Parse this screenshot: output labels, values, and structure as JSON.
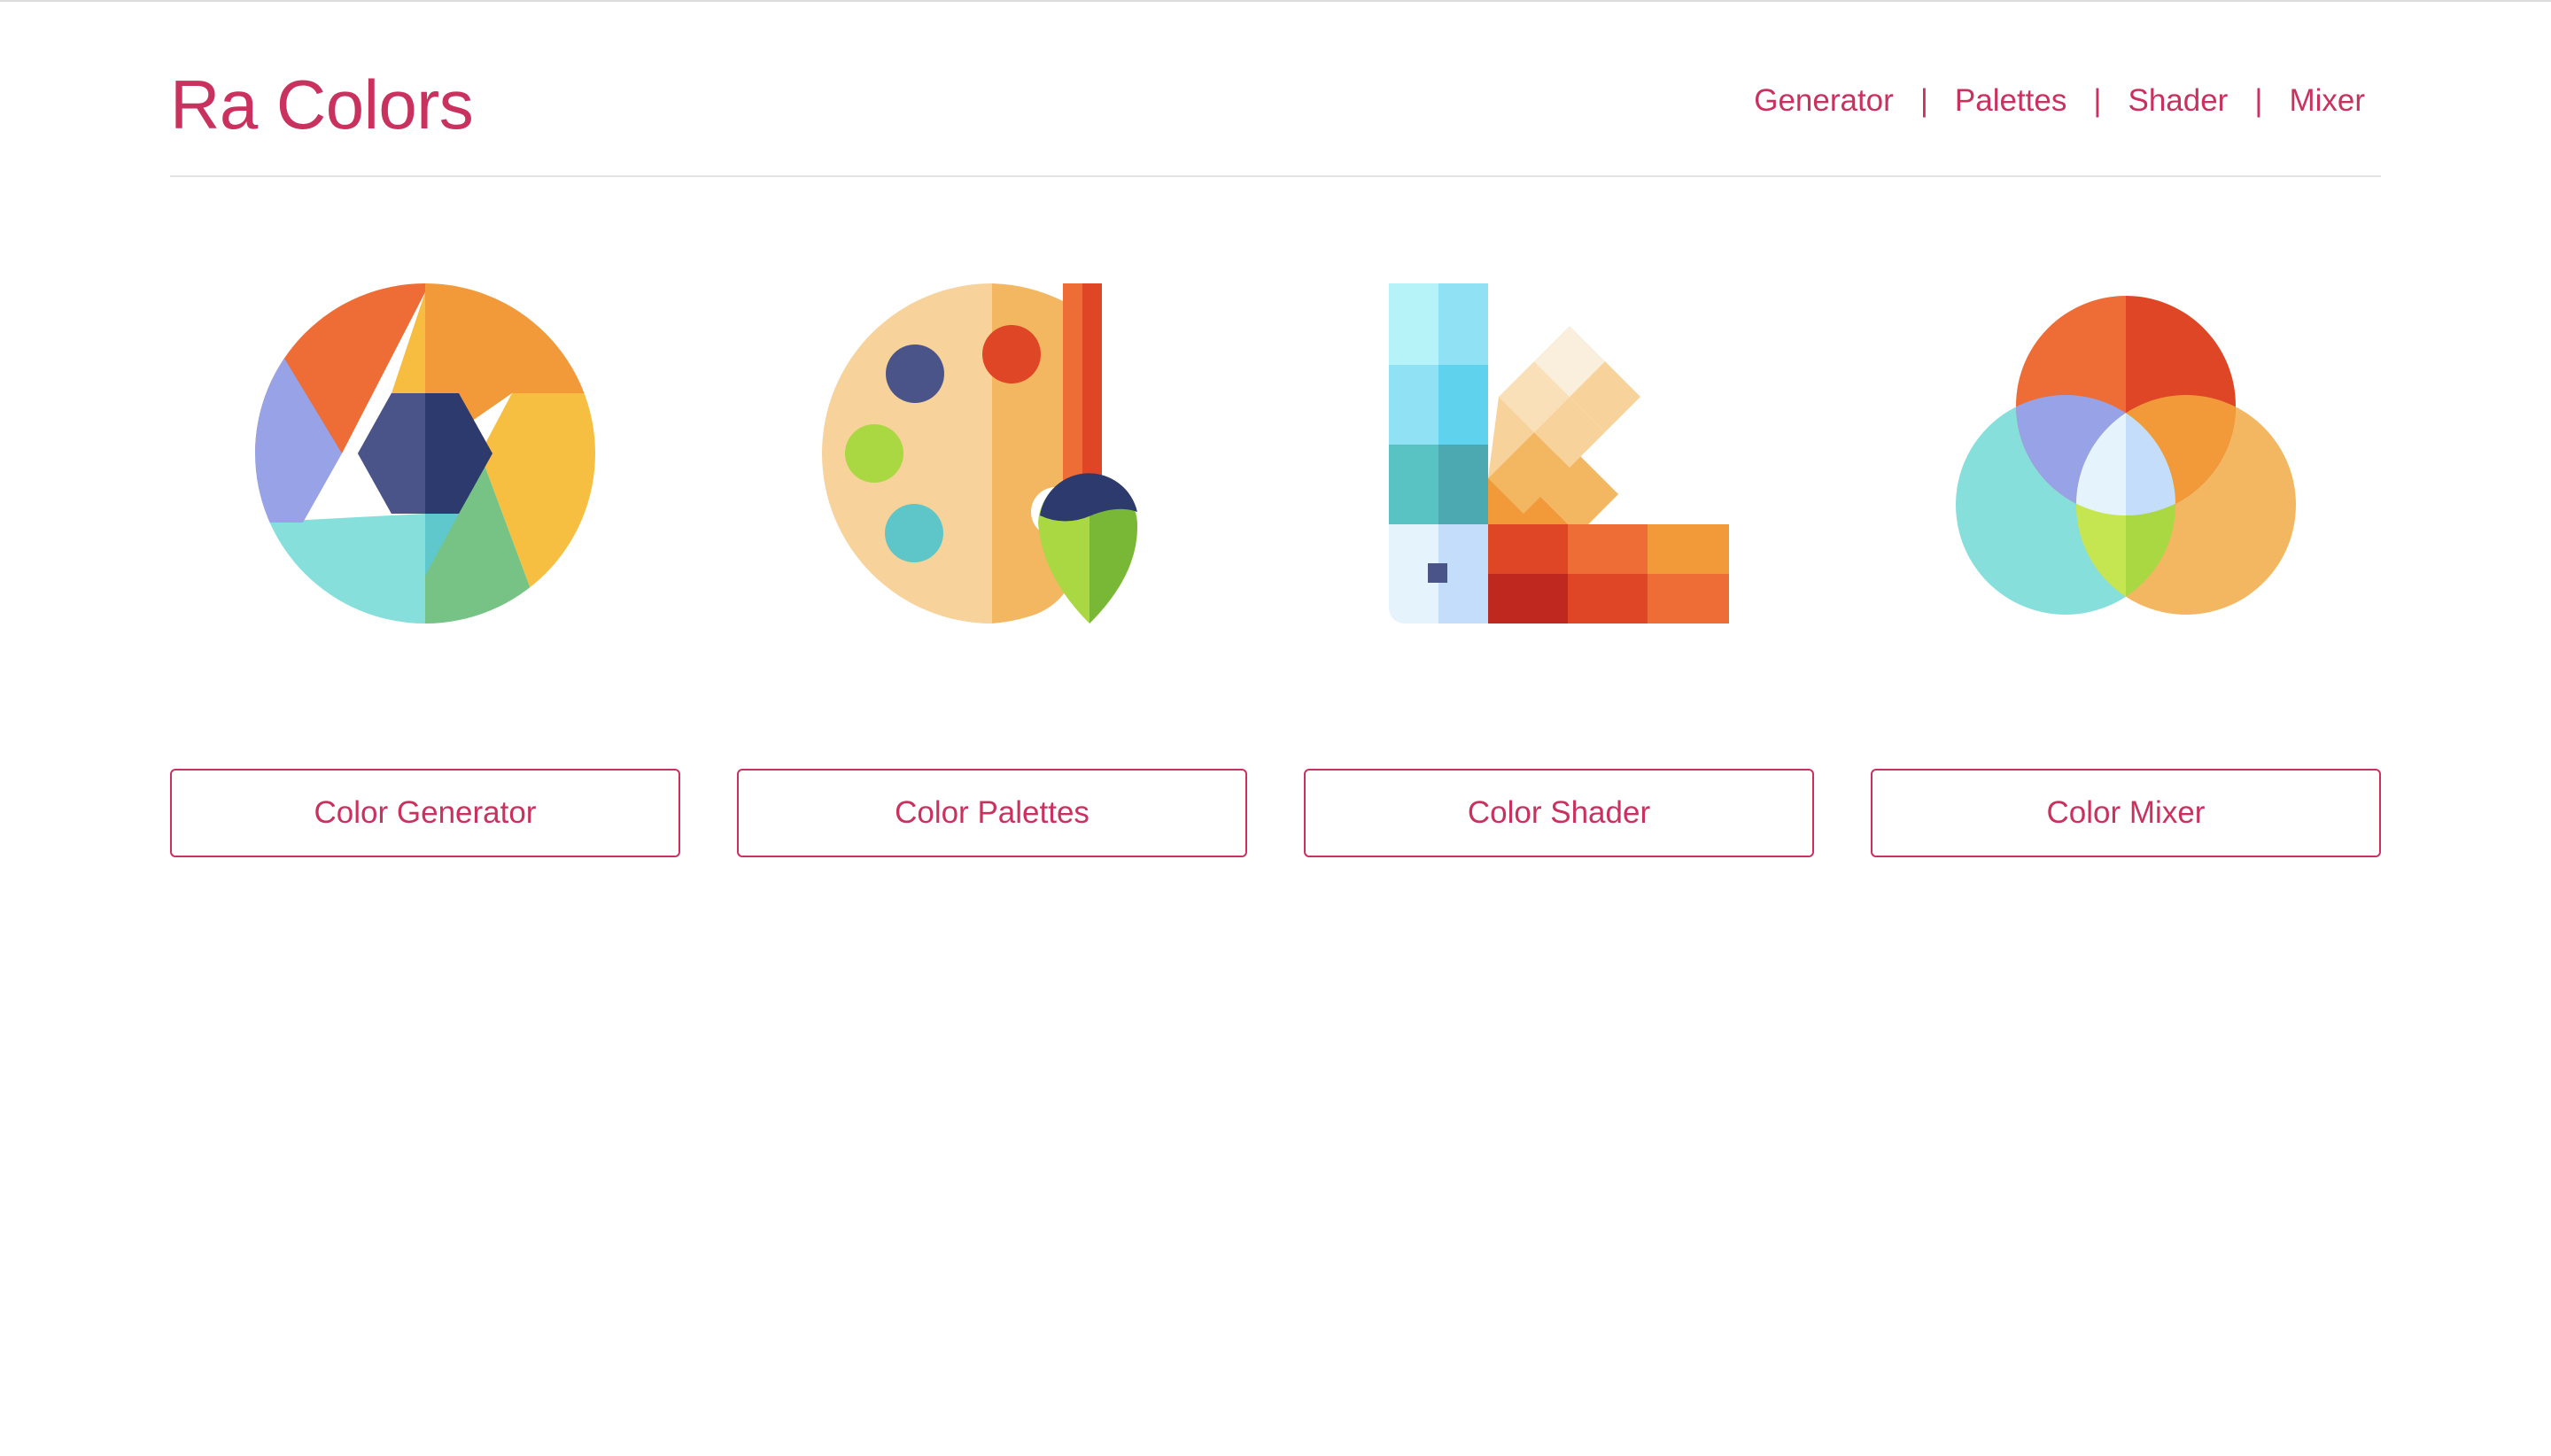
{
  "header": {
    "brand": "Ra Colors",
    "nav": [
      {
        "label": "Generator"
      },
      {
        "label": "Palettes"
      },
      {
        "label": "Shader"
      },
      {
        "label": "Mixer"
      }
    ],
    "separator": "|"
  },
  "cards": [
    {
      "icon": "color-wheel-icon",
      "button_label": "Color Generator"
    },
    {
      "icon": "paint-palette-icon",
      "button_label": "Color Palettes"
    },
    {
      "icon": "color-swatch-fan-icon",
      "button_label": "Color Shader"
    },
    {
      "icon": "color-mix-circles-icon",
      "button_label": "Color Mixer"
    }
  ],
  "colors": {
    "accent": "#c9325f",
    "divider": "#e3e3e3"
  }
}
